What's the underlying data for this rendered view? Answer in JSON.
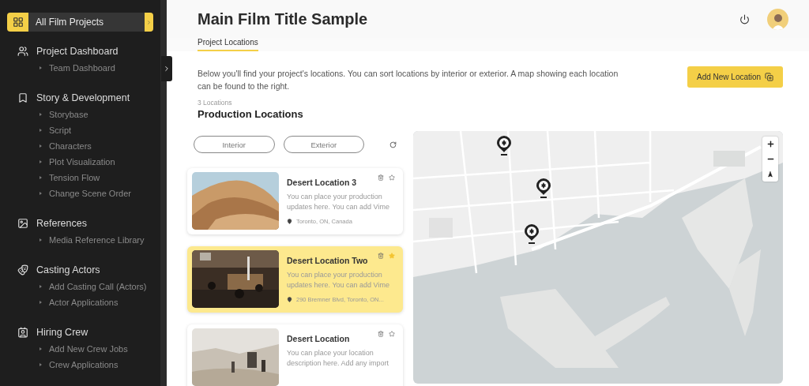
{
  "sidebar": {
    "top_item": {
      "label": "All Film Projects",
      "selected": true
    },
    "sections": [
      {
        "title": "Project Dashboard",
        "children": [
          {
            "label": "Team Dashboard"
          }
        ]
      },
      {
        "title": "Story & Development",
        "children": [
          {
            "label": "Storybase"
          },
          {
            "label": "Script"
          },
          {
            "label": "Characters"
          },
          {
            "label": "Plot Visualization"
          },
          {
            "label": "Tension Flow"
          },
          {
            "label": "Change Scene Order"
          }
        ]
      },
      {
        "title": "References",
        "children": [
          {
            "label": "Media Reference Library"
          }
        ]
      },
      {
        "title": "Casting Actors",
        "children": [
          {
            "label": "Add Casting Call (Actors)"
          },
          {
            "label": "Actor Applications"
          }
        ]
      },
      {
        "title": "Hiring Crew",
        "children": [
          {
            "label": "Add New Crew Jobs"
          },
          {
            "label": "Crew Applications"
          }
        ]
      }
    ]
  },
  "header": {
    "title": "Main Film Title Sample"
  },
  "tabs": [
    {
      "label": "Project Locations",
      "selected": true
    }
  ],
  "intro": "Below you'll find your project's locations. You can sort locations by interior or exterior. A map showing each location can be found to the right.",
  "add_button": "Add New Location",
  "count": "3 Locations",
  "section_title": "Production Locations",
  "filters": [
    {
      "label": "Interior",
      "selected": false
    },
    {
      "label": "Exterior",
      "selected": false
    }
  ],
  "locations": [
    {
      "title": "Desert Location 3",
      "description": "You can place your production updates here. You can add Vime",
      "address": "Toronto, ON, Canada",
      "selected": false,
      "starred": false
    },
    {
      "title": "Desert Location Two",
      "description": "You can place your production updates here. You can add Vime",
      "address": "290 Bremner Blvd, Toronto, ON...",
      "selected": true,
      "starred": true
    },
    {
      "title": "Desert Location",
      "description": "You can place your location description here. Add any import",
      "selected": false,
      "starred": false
    }
  ]
}
